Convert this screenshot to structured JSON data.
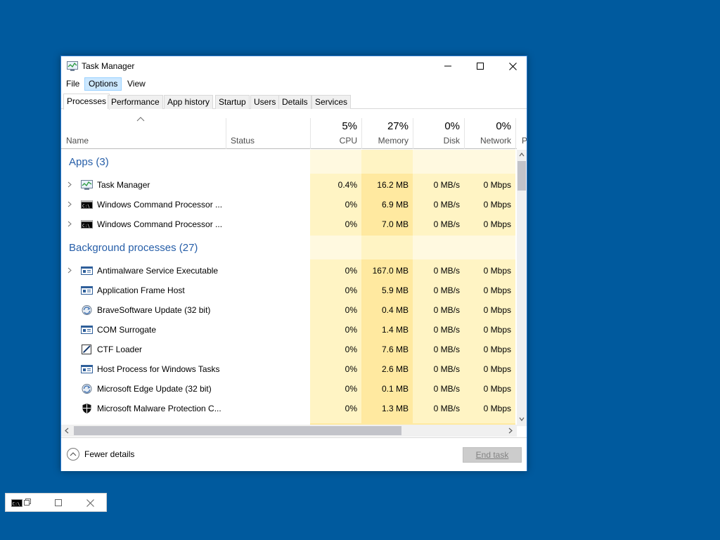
{
  "window": {
    "title": "Task Manager",
    "menu": [
      "File",
      "Options",
      "View"
    ],
    "tabs": [
      "Processes",
      "Performance",
      "App history",
      "Startup",
      "Users",
      "Details",
      "Services"
    ]
  },
  "header": {
    "name": "Name",
    "status": "Status",
    "cpu": {
      "pct": "5%",
      "label": "CPU"
    },
    "memory": {
      "pct": "27%",
      "label": "Memory"
    },
    "disk": {
      "pct": "0%",
      "label": "Disk"
    },
    "network": {
      "pct": "0%",
      "label": "Network"
    },
    "power_partial": "P"
  },
  "groups": {
    "apps": "Apps (3)",
    "background": "Background processes (27)"
  },
  "apps": [
    {
      "name": "Task Manager",
      "icon": "task-manager-icon",
      "cpu": "0.4%",
      "memory": "16.2 MB",
      "disk": "0 MB/s",
      "network": "0 Mbps"
    },
    {
      "name": "Windows Command Processor ...",
      "icon": "cmd-icon",
      "cpu": "0%",
      "memory": "6.9 MB",
      "disk": "0 MB/s",
      "network": "0 Mbps"
    },
    {
      "name": "Windows Command Processor ...",
      "icon": "cmd-icon",
      "cpu": "0%",
      "memory": "7.0 MB",
      "disk": "0 MB/s",
      "network": "0 Mbps"
    }
  ],
  "background": [
    {
      "name": "Antimalware Service Executable",
      "icon": "service-window-icon",
      "cpu": "0%",
      "memory": "167.0 MB",
      "disk": "0 MB/s",
      "network": "0 Mbps"
    },
    {
      "name": "Application Frame Host",
      "icon": "service-window-icon",
      "cpu": "0%",
      "memory": "5.9 MB",
      "disk": "0 MB/s",
      "network": "0 Mbps"
    },
    {
      "name": "BraveSoftware Update (32 bit)",
      "icon": "updater-icon",
      "cpu": "0%",
      "memory": "0.4 MB",
      "disk": "0 MB/s",
      "network": "0 Mbps"
    },
    {
      "name": "COM Surrogate",
      "icon": "service-window-icon",
      "cpu": "0%",
      "memory": "1.4 MB",
      "disk": "0 MB/s",
      "network": "0 Mbps"
    },
    {
      "name": "CTF Loader",
      "icon": "ctf-pen-icon",
      "cpu": "0%",
      "memory": "7.6 MB",
      "disk": "0 MB/s",
      "network": "0 Mbps"
    },
    {
      "name": "Host Process for Windows Tasks",
      "icon": "service-window-icon",
      "cpu": "0%",
      "memory": "2.6 MB",
      "disk": "0 MB/s",
      "network": "0 Mbps"
    },
    {
      "name": "Microsoft Edge Update (32 bit)",
      "icon": "updater-icon",
      "cpu": "0%",
      "memory": "0.1 MB",
      "disk": "0 MB/s",
      "network": "0 Mbps"
    },
    {
      "name": "Microsoft Malware Protection C...",
      "icon": "shield-icon",
      "cpu": "0%",
      "memory": "1.3 MB",
      "disk": "0 MB/s",
      "network": "0 Mbps"
    }
  ],
  "footer": {
    "fewer_details": "Fewer details",
    "end_task": "End task"
  },
  "colors": {
    "desktop": "#005a9e",
    "group_title": "#265ea8",
    "heat_light": "#fff4c4",
    "heat_medium": "#ffe9a0",
    "heat_group": "#fff9e0"
  }
}
